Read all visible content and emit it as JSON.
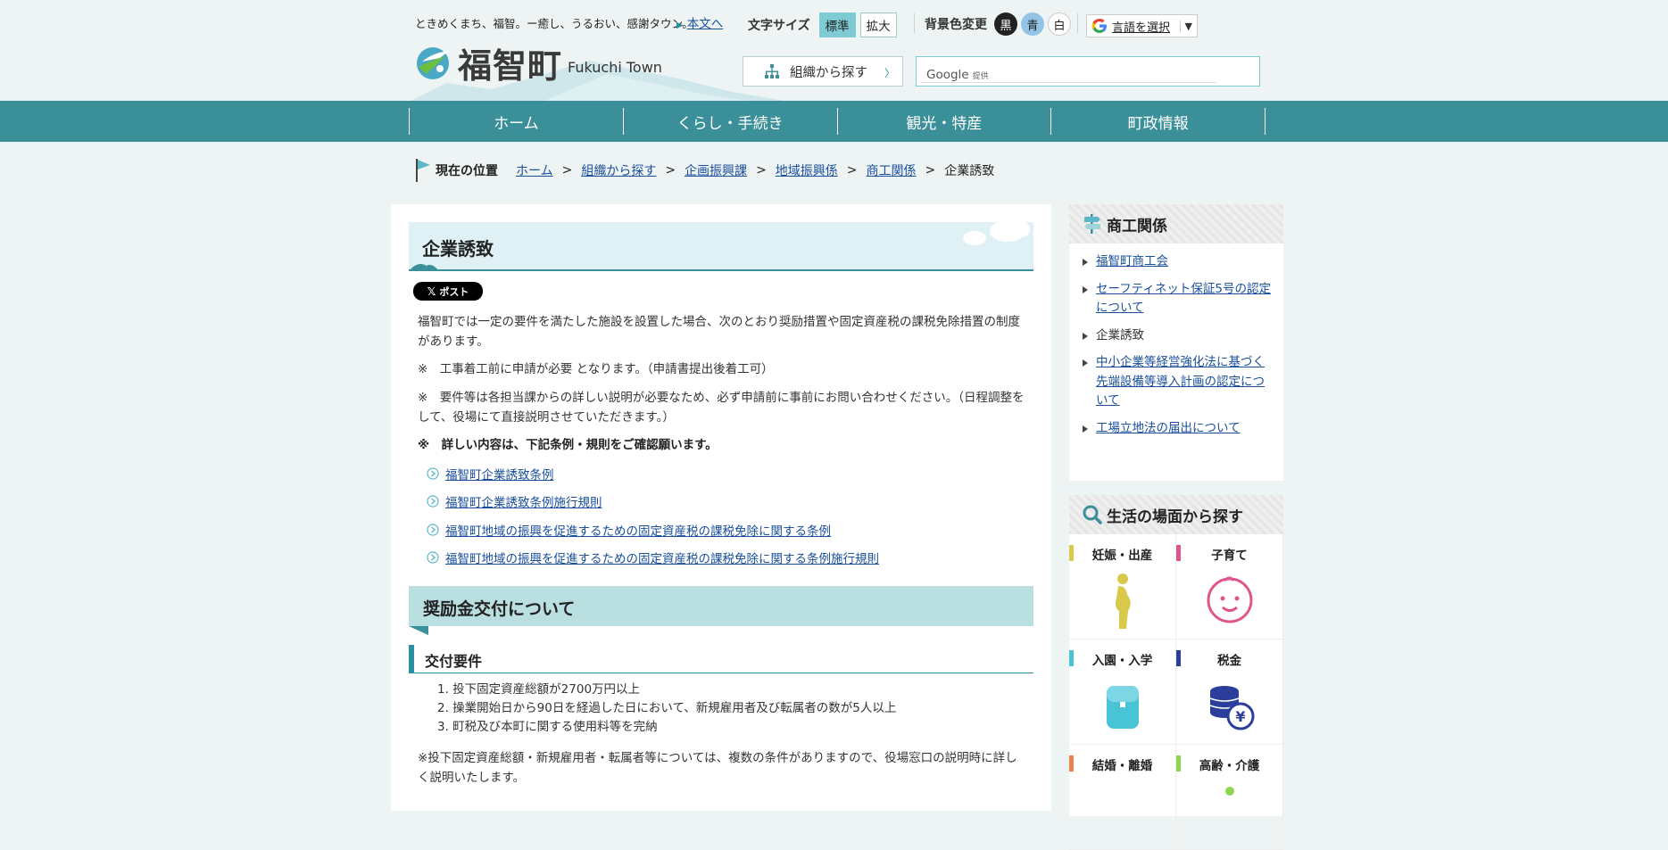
{
  "header": {
    "tagline": "ときめくまち、福智。ー癒し、うるおい、感謝タウン。",
    "skip_link": "本文へ",
    "logo_jp": "福智町",
    "logo_en": "Fukuchi Town",
    "font_size_label": "文字サイズ",
    "font_standard": "標準",
    "font_large": "拡大",
    "bg_label": "背景色変更",
    "bg_black": "黒",
    "bg_blue": "青",
    "bg_white": "白",
    "lang_label": "言語を選択",
    "lang_arrow": "▼",
    "org_search": "組織から探す",
    "search_google": "Google",
    "search_provided": "提供"
  },
  "nav": [
    "ホーム",
    "くらし・手続き",
    "観光・特産",
    "町政情報"
  ],
  "breadcrumb": {
    "current_label": "現在の位置",
    "items": [
      "ホーム",
      "組織から探す",
      "企画振興課",
      "地域振興係",
      "商工関係"
    ],
    "last": "企業誘致"
  },
  "main": {
    "title": "企業誘致",
    "x_post": "ポスト",
    "intro": "福智町では一定の要件を満たした施設を設置した場合、次のとおり奨励措置や固定資産税の課税免除措置の制度があります。",
    "note1": "※　工事着工前に申請が必要 となります。（申請書提出後着工可）",
    "note2": "※　要件等は各担当課からの詳しい説明が必要なため、必ず申請前に事前にお問い合わせください。（日程調整をして、役場にて直接説明させていただきます。）",
    "note3": "※　詳しい内容は、下記条例・規則をご確認願います。",
    "links": [
      "福智町企業誘致条例",
      "福智町企業誘致条例施行規則",
      "福智町地域の振興を促進するための固定資産税の課税免除に関する条例",
      "福智町地域の振興を促進するための固定資産税の課税免除に関する条例施行規則"
    ],
    "h2": "奨励金交付について",
    "h3": "交付要件",
    "requirements": [
      "1. 投下固定資産総額が2700万円以上",
      "2. 操業開始日から90日を経過した日において、新規雇用者及び転属者の数が5人以上",
      "3. 町税及び本町に関する使用料等を完納"
    ],
    "footnote": "※投下固定資産総額・新規雇用者・転属者等については、複数の条件がありますので、役場窓口の説明時に詳しく説明いたします。"
  },
  "sidebar": {
    "section_title": "商工関係",
    "items": [
      {
        "label": "福智町商工会",
        "link": true
      },
      {
        "label": "セーフティネット保証5号の認定について",
        "link": true
      },
      {
        "label": "企業誘致",
        "link": false
      },
      {
        "label": "中小企業等経営強化法に基づく先端設備等導入計画の認定について",
        "link": true
      },
      {
        "label": "工場立地法の届出について",
        "link": true
      }
    ],
    "life_title": "生活の場面から探す",
    "life": [
      {
        "label": "妊娠・出産",
        "color": "#d8c94a",
        "icon": "pregnant-icon"
      },
      {
        "label": "子育て",
        "color": "#e0558c",
        "icon": "baby-icon"
      },
      {
        "label": "入園・入学",
        "color": "#49c3d6",
        "icon": "school-bag-icon"
      },
      {
        "label": "税金",
        "color": "#2b3e9c",
        "icon": "coins-yen-icon"
      },
      {
        "label": "結婚・離婚",
        "color": "#e8824a",
        "icon": "marriage-icon"
      },
      {
        "label": "高齢・介護",
        "color": "#8fd650",
        "icon": "elderly-icon"
      }
    ]
  },
  "colors": {
    "accent": "#3a8f98",
    "title_bg": "#dff1f4",
    "h2_bg": "#b9dfe1",
    "link": "#1a4f9c"
  }
}
